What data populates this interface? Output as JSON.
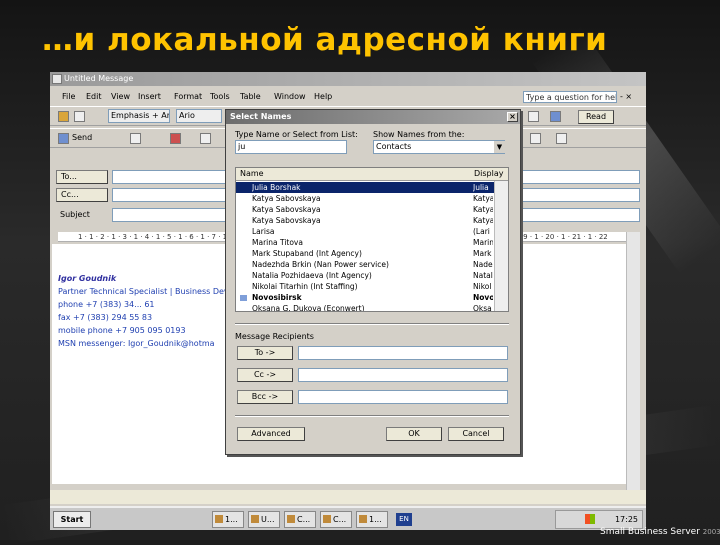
{
  "slide": {
    "title": "…и локальной адресной книги"
  },
  "window": {
    "title": "Untitled Message",
    "ask_placeholder": "Type a question for help"
  },
  "menu": [
    "File",
    "Edit",
    "View",
    "Insert",
    "Format",
    "Tools",
    "Table",
    "Window",
    "Help"
  ],
  "toolbar": {
    "style": "Emphasis + Ari",
    "font": "Ario",
    "read": "Read",
    "send": "Send"
  },
  "message": {
    "to_label": "To...",
    "cc_label": "Cc...",
    "subject_label": "Subject",
    "ruler": "1 · 1 · 2 · 1 · 3 · 1 · 4 · 1 · 5 · 1 · 6 · 1 · 7 · 1 · 8 · 1 · 9 · 1 · 10 · 1 · 11 · 1 · 12 · 1 · 13 · 1 · 14 · 1 · 15 · 1 · 16 · 1 · 17 · 1 · 18 · 1 · 19 · 1 · 20 · 1 · 21 · 1 · 22"
  },
  "signature": [
    "Igor Goudnik",
    "Partner Technical Specialist | Business Develo",
    "phone +7 (383) 34... 61",
    "fax +7 (383) 294 55 83",
    "mobile phone +7 905 095 0193",
    "MSN messenger: Igor_Goudnik@hotma"
  ],
  "dialog": {
    "title": "Select Names",
    "type_label": "Type Name or Select from List:",
    "type_value": "ju",
    "show_label": "Show Names from the:",
    "show_value": "Contacts",
    "col_name": "Name",
    "col_display": "Display",
    "rows": [
      {
        "name": "Julia Borshak",
        "display": "Julia"
      },
      {
        "name": "Katya Sabovskaya",
        "display": "Katya"
      },
      {
        "name": "Katya Sabovskaya",
        "display": "Katya"
      },
      {
        "name": "Katya Sabovskaya",
        "display": "Katya"
      },
      {
        "name": "Larisa",
        "display": "(Lari"
      },
      {
        "name": "Marina Titova",
        "display": "Marin"
      },
      {
        "name": "Mark Stupaband (Int Agency)",
        "display": "Mark"
      },
      {
        "name": "Nadezhda Brkin (Nan Power service)",
        "display": "Nadez"
      },
      {
        "name": "Natalia Pozhidaeva (Int Agency)",
        "display": "Natal"
      },
      {
        "name": "Nikolai Titarhin (Int Staffing)",
        "display": "Nikol"
      },
      {
        "name": "Novosibirsk",
        "display": "Novo"
      },
      {
        "name": "Oksana G. Dukova (Econwert)",
        "display": "Oksa"
      }
    ],
    "recipients_label": "Message Recipients",
    "to_btn": "To ->",
    "cc_btn": "Cc ->",
    "bcc_btn": "Bcc ->",
    "advanced_btn": "Advanced",
    "ok_btn": "OK",
    "cancel_btn": "Cancel"
  },
  "taskbar": {
    "start": "Start",
    "tasks": [
      "1...",
      "U...",
      "C...",
      "C...",
      "1...",
      "EN"
    ],
    "clock": "17:25"
  },
  "branding": {
    "product": "Small Business Server",
    "year": "2003"
  }
}
